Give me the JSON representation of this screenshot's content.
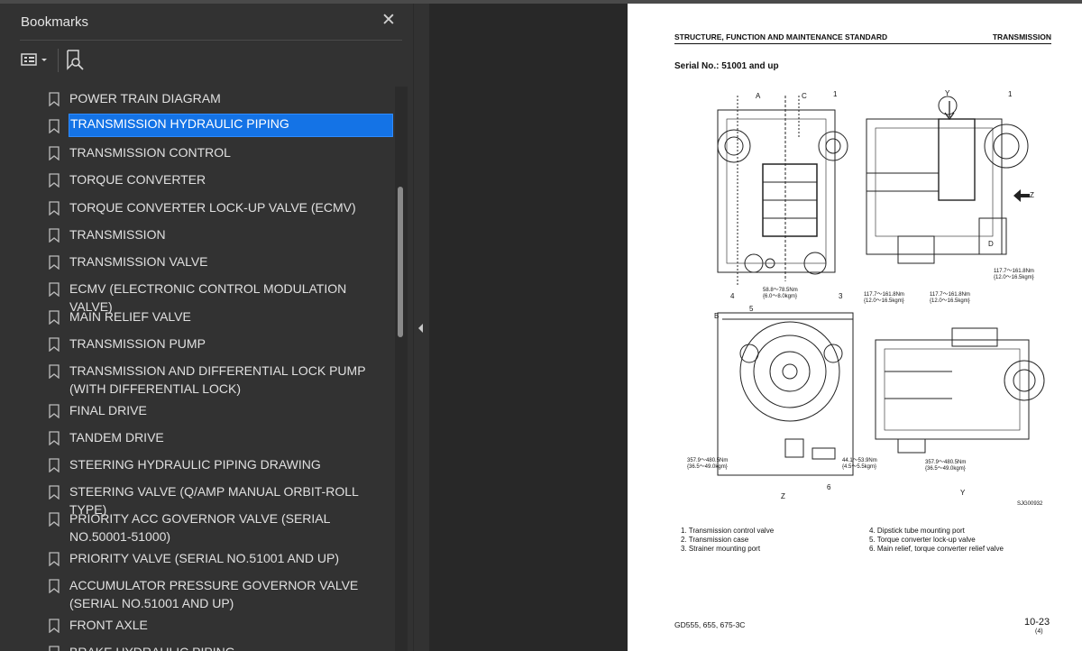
{
  "panel": {
    "title": "Bookmarks",
    "close_glyph": "✕",
    "bookmarks": [
      {
        "label": "POWER TRAIN DIAGRAM"
      },
      {
        "label": "TRANSMISSION HYDRAULIC PIPING",
        "selected": true
      },
      {
        "label": "TRANSMISSION CONTROL"
      },
      {
        "label": "TORQUE CONVERTER"
      },
      {
        "label": "TORQUE CONVERTER LOCK-UP VALVE (ECMV)"
      },
      {
        "label": "TRANSMISSION"
      },
      {
        "label": "TRANSMISSION VALVE"
      },
      {
        "label": "ECMV (ELECTRONIC CONTROL MODULATION VALVE)"
      },
      {
        "label": "MAIN RELIEF VALVE"
      },
      {
        "label": "TRANSMISSION PUMP"
      },
      {
        "label": "TRANSMISSION AND DIFFERENTIAL LOCK PUMP (WITH DIFFERENTIAL LOCK)"
      },
      {
        "label": "FINAL DRIVE"
      },
      {
        "label": "TANDEM DRIVE"
      },
      {
        "label": "STEERING HYDRAULIC PIPING DRAWING"
      },
      {
        "label": "STEERING VALVE (Q/AMP MANUAL ORBIT-ROLL TYPE)"
      },
      {
        "label": "PRIORITY ACC GOVERNOR VALVE (SERIAL NO.50001-51000)"
      },
      {
        "label": "PRIORITY VALVE (SERIAL NO.51001 AND UP)"
      },
      {
        "label": "ACCUMULATOR PRESSURE GOVERNOR VALVE (SERIAL NO.51001 AND UP)"
      },
      {
        "label": "FRONT AXLE"
      },
      {
        "label": "BRAKE HYDRAULIC PIPING"
      }
    ]
  },
  "page": {
    "header_left": "STRUCTURE, FUNCTION AND MAINTENANCE STANDARD",
    "header_right": "TRANSMISSION",
    "serial": "Serial No.: 51001 and up",
    "figure_labels": {
      "A": "A",
      "B": "B",
      "C": "C",
      "D": "D",
      "Y": "Y",
      "Z": "Z",
      "n1": "1",
      "n2": "2",
      "n3": "3",
      "n4": "4",
      "n5": "5",
      "n6": "6",
      "code": "SJG00932"
    },
    "torques": [
      "58.8～78.5Nm\n{6.0～8.0kgm}",
      "117.7～161.8Nm\n{12.0～16.5kgm}",
      "117.7～161.8Nm\n{12.0～16.5kgm}",
      "117.7～161.8Nm\n{12.0～16.5kgm}",
      "357.9～480.5Nm\n{36.5～49.0kgm}",
      "44.1～53.9Nm\n{4.5～5.5kgm}",
      "357.9～480.5Nm\n{36.5～49.0kgm}"
    ],
    "captions": [
      "1. Transmission control valve",
      "2. Transmission case",
      "3. Strainer mounting port",
      "4. Dipstick tube mounting port",
      "5. Torque converter lock-up valve",
      "6. Main relief, torque converter relief valve"
    ],
    "footer_left": "GD555, 655, 675-3C",
    "footer_right": "10-23",
    "footer_sub": "(4)"
  }
}
